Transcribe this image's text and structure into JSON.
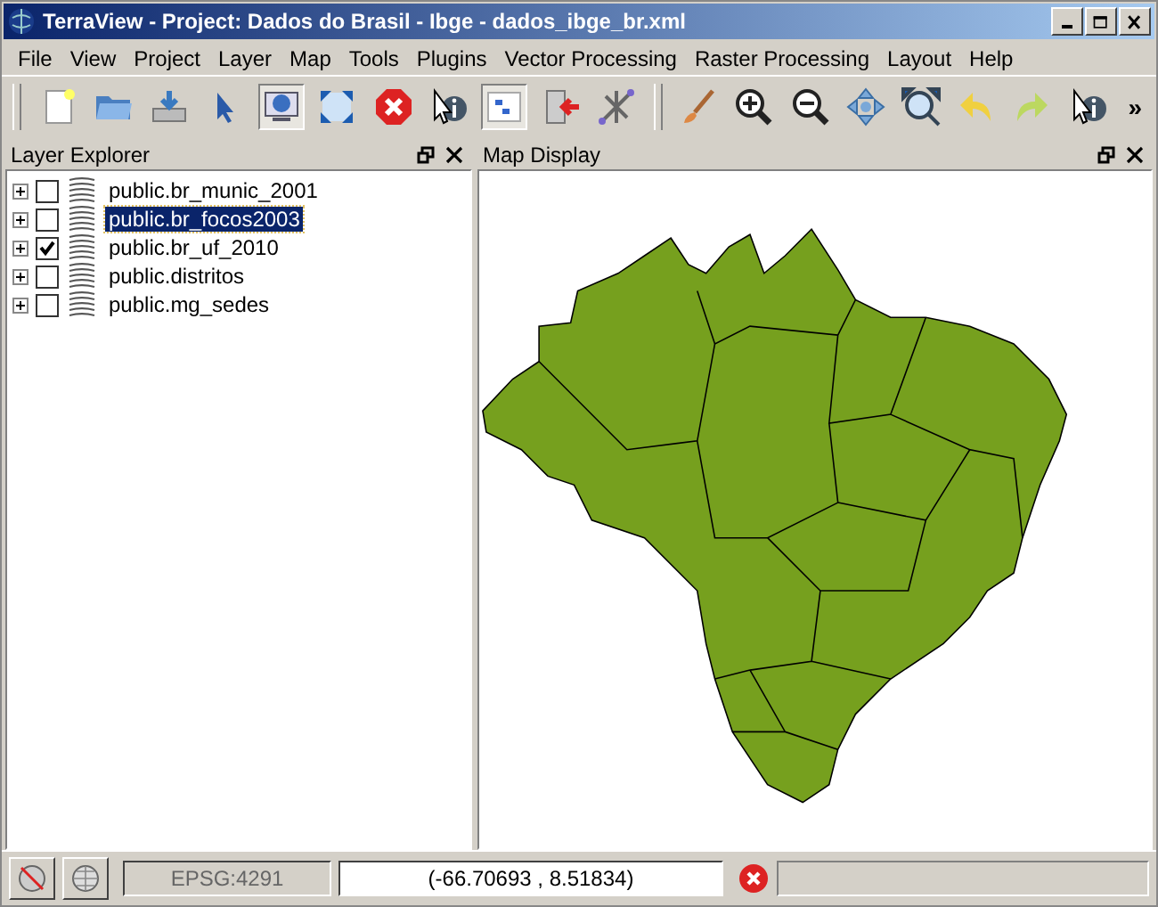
{
  "window": {
    "title": "TerraView - Project: Dados do Brasil - Ibge - dados_ibge_br.xml"
  },
  "menu": [
    {
      "label": "File"
    },
    {
      "label": "View"
    },
    {
      "label": "Project"
    },
    {
      "label": "Layer"
    },
    {
      "label": "Map"
    },
    {
      "label": "Tools"
    },
    {
      "label": "Plugins"
    },
    {
      "label": "Vector Processing"
    },
    {
      "label": "Raster Processing"
    },
    {
      "label": "Layout"
    },
    {
      "label": "Help"
    }
  ],
  "toolbars": [
    [
      {
        "kind": "new",
        "pressed": false
      },
      {
        "kind": "open",
        "pressed": false
      },
      {
        "kind": "save",
        "pressed": false
      },
      {
        "kind": "pointer",
        "pressed": false
      },
      {
        "kind": "display",
        "pressed": true
      },
      {
        "kind": "extent",
        "pressed": false
      },
      {
        "kind": "stop",
        "pressed": false
      },
      {
        "kind": "info",
        "pressed": false
      },
      {
        "kind": "tree",
        "pressed": true
      },
      {
        "kind": "exit",
        "pressed": false
      },
      {
        "kind": "measure",
        "pressed": false
      }
    ],
    [
      {
        "kind": "brush",
        "pressed": false
      },
      {
        "kind": "zoomin",
        "pressed": false
      },
      {
        "kind": "zoomout",
        "pressed": false
      },
      {
        "kind": "pan",
        "pressed": false
      },
      {
        "kind": "zoomext",
        "pressed": false
      },
      {
        "kind": "undo",
        "pressed": false
      },
      {
        "kind": "redo",
        "pressed": false
      },
      {
        "kind": "info",
        "pressed": false
      }
    ]
  ],
  "toolbar_more": "»",
  "layer_explorer": {
    "title": "Layer Explorer",
    "layers": [
      {
        "name": "public.br_munic_2001",
        "checked": false,
        "selected": false
      },
      {
        "name": "public.br_focos2003",
        "checked": false,
        "selected": true
      },
      {
        "name": "public.br_uf_2010",
        "checked": true,
        "selected": false
      },
      {
        "name": "public.distritos",
        "checked": false,
        "selected": false
      },
      {
        "name": "public.mg_sedes",
        "checked": false,
        "selected": false
      }
    ]
  },
  "map_display": {
    "title": "Map Display"
  },
  "status_bar": {
    "srid": "EPSG:4291",
    "coordinates": "(-66.70693 , 8.51834)"
  }
}
